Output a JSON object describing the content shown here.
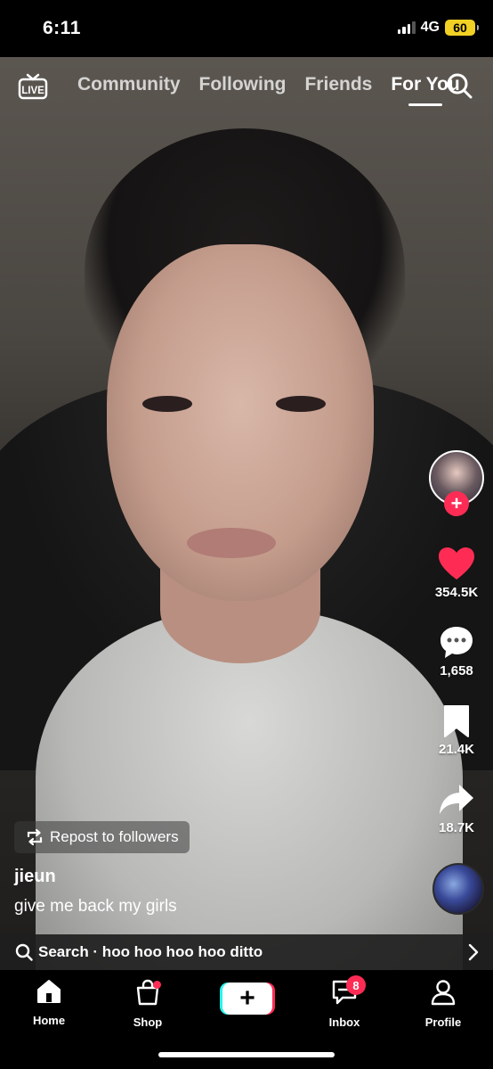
{
  "status": {
    "time": "6:11",
    "network": "4G",
    "battery": "60"
  },
  "top_nav": {
    "live_label": "LIVE",
    "tabs": [
      {
        "label": "Community",
        "active": false
      },
      {
        "label": "Following",
        "active": false
      },
      {
        "label": "Friends",
        "active": false
      },
      {
        "label": "For You",
        "active": true
      }
    ]
  },
  "actions": {
    "likes": "354.5K",
    "comments": "1,658",
    "bookmarks": "21.4K",
    "shares": "18.7K"
  },
  "post": {
    "repost_label": "Repost to followers",
    "username": "jieun",
    "caption": "give me back my girls"
  },
  "search_bar": {
    "text": "Search · hoo hoo hoo hoo ditto"
  },
  "bottom_nav": {
    "home": "Home",
    "shop": "Shop",
    "inbox": "Inbox",
    "inbox_badge": "8",
    "profile": "Profile"
  },
  "colors": {
    "accent": "#fe2c55",
    "cyan": "#25f4ee",
    "battery": "#f2d024"
  }
}
